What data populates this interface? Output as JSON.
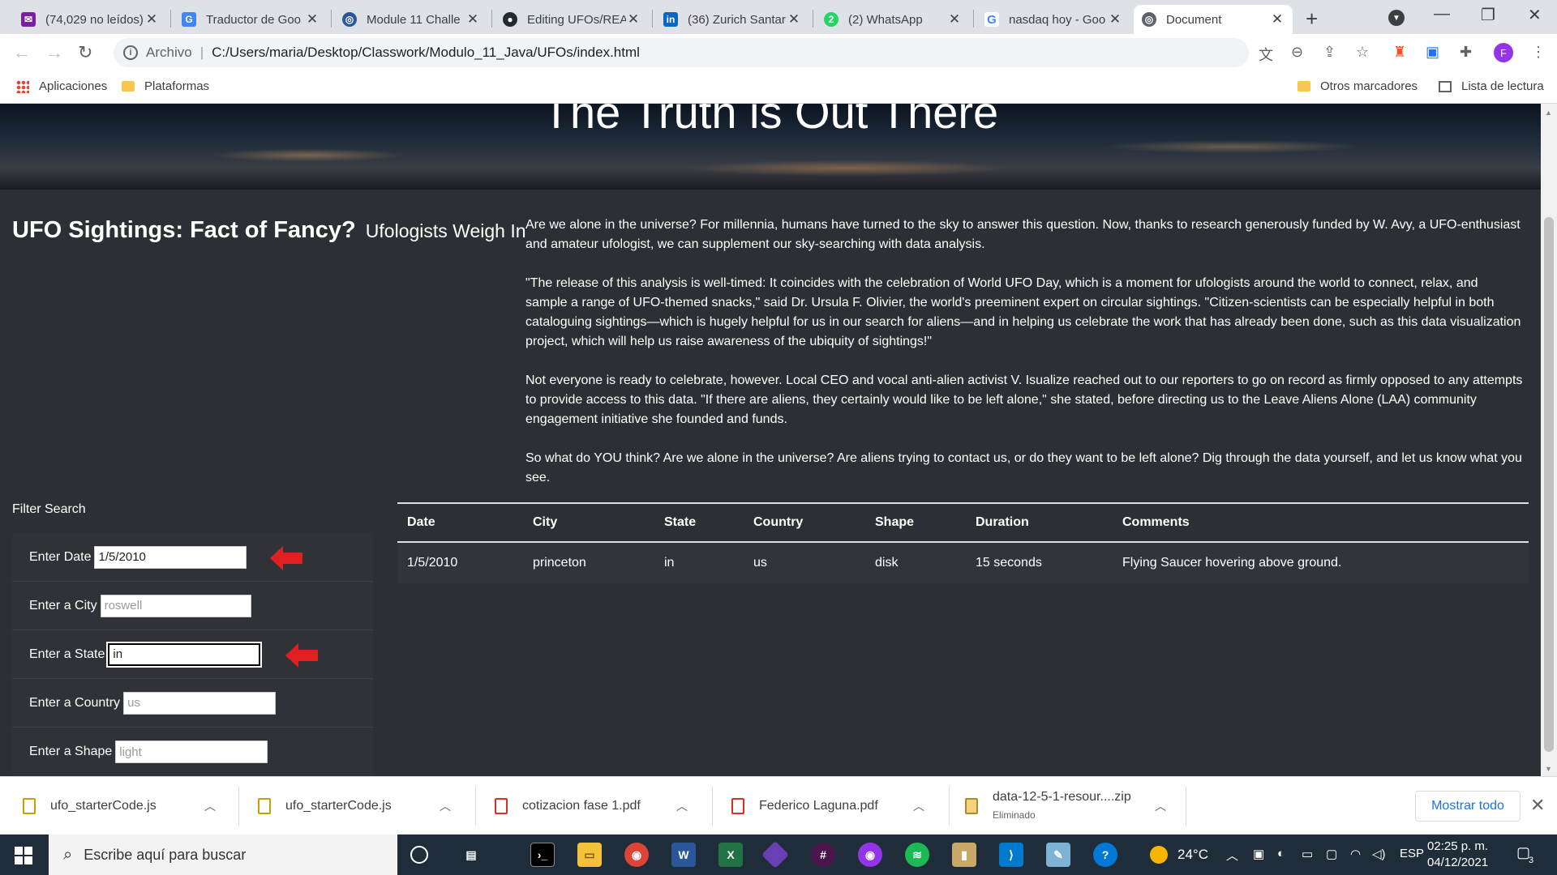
{
  "browser": {
    "tabs": [
      {
        "title": "(74,029 no leídos)",
        "favicon": "mail-icon",
        "color": "#7b1fa2"
      },
      {
        "title": "Traductor de Goo",
        "favicon": "translate-icon",
        "color": "#4285f4"
      },
      {
        "title": "Module 11 Challe",
        "favicon": "globe-icon",
        "color": "#2b579a"
      },
      {
        "title": "Editing UFOs/REA",
        "favicon": "github-icon",
        "color": "#24292e"
      },
      {
        "title": "(36) Zurich Santar",
        "favicon": "linkedin-icon",
        "color": "#0a66c2"
      },
      {
        "title": "(2) WhatsApp",
        "favicon": "whatsapp-icon",
        "color": "#25d366"
      },
      {
        "title": "nasdaq hoy - Goo",
        "favicon": "google-icon",
        "color": "#4285f4"
      },
      {
        "title": "Document",
        "favicon": "globe-icon",
        "color": "#5f6368"
      }
    ],
    "active_tab": 7,
    "address": {
      "security_label": "Archivo",
      "url": "C:/Users/maria/Desktop/Classwork/Modulo_11_Java/UFOs/index.html"
    },
    "bookmarks": {
      "apps": "Aplicaciones",
      "platforms": "Plataformas",
      "others": "Otros marcadores",
      "reading_list": "Lista de lectura"
    },
    "profile_initial": "F"
  },
  "page": {
    "hero_title": "The Truth is Out There",
    "headline": "UFO Sightings: Fact of Fancy?",
    "headline_sub": "Ufologists Weigh In",
    "paragraphs": [
      "Are we alone in the universe? For millennia, humans have turned to the sky to answer this question. Now, thanks to research generously funded by W. Avy, a UFO-enthusiast and amateur ufologist, we can supplement our sky-searching with data analysis.",
      "\"The release of this analysis is well-timed: It coincides with the celebration of World UFO Day, which is a moment for ufologists around the world to connect, relax, and sample a range of UFO-themed snacks,\" said Dr. Ursula F. Olivier, the world's preeminent expert on circular sightings. \"Citizen-scientists can be especially helpful in both cataloguing sightings—which is hugely helpful for us in our search for aliens—and in helping us celebrate the work that has already been done, such as this data visualization project, which will help us raise awareness of the ubiquity of sightings!\"",
      "Not everyone is ready to celebrate, however. Local CEO and vocal anti-alien activist V. Isualize reached out to our reporters to go on record as firmly opposed to any attempts to provide access to this data. \"If there are aliens, they certainly would like to be left alone,\" she stated, before directing us to the Leave Aliens Alone (LAA) community engagement initiative she founded and funds.",
      "So what do YOU think? Are we alone in the universe? Are aliens trying to contact us, or do they want to be left alone? Dig through the data yourself, and let us know what you see."
    ],
    "filter": {
      "title": "Filter Search",
      "date": {
        "label": "Enter Date",
        "value": "1/5/2010",
        "placeholder": ""
      },
      "city": {
        "label": "Enter a City",
        "value": "",
        "placeholder": "roswell"
      },
      "state": {
        "label": "Enter a State",
        "value": "in",
        "placeholder": ""
      },
      "country": {
        "label": "Enter a Country",
        "value": "",
        "placeholder": "us"
      },
      "shape": {
        "label": "Enter a Shape",
        "value": "",
        "placeholder": "light"
      }
    },
    "table": {
      "headers": [
        "Date",
        "City",
        "State",
        "Country",
        "Shape",
        "Duration",
        "Comments"
      ],
      "rows": [
        [
          "1/5/2010",
          "princeton",
          "in",
          "us",
          "disk",
          "15 seconds",
          "Flying Saucer hovering above ground."
        ]
      ]
    },
    "arrow_color": "#e02020"
  },
  "downloads": {
    "items": [
      {
        "name": "ufo_starterCode.js",
        "status": ""
      },
      {
        "name": "ufo_starterCode.js",
        "status": ""
      },
      {
        "name": "cotizacion fase 1.pdf",
        "status": ""
      },
      {
        "name": "Federico Laguna.pdf",
        "status": ""
      },
      {
        "name": "data-12-5-1-resour....zip",
        "status": "Eliminado"
      }
    ],
    "show_all": "Mostrar todo"
  },
  "taskbar": {
    "search_placeholder": "Escribe aquí para buscar",
    "temperature": "24°C",
    "language": "ESP",
    "time": "02:25 p. m.",
    "date": "04/12/2021",
    "notifications": "3"
  }
}
